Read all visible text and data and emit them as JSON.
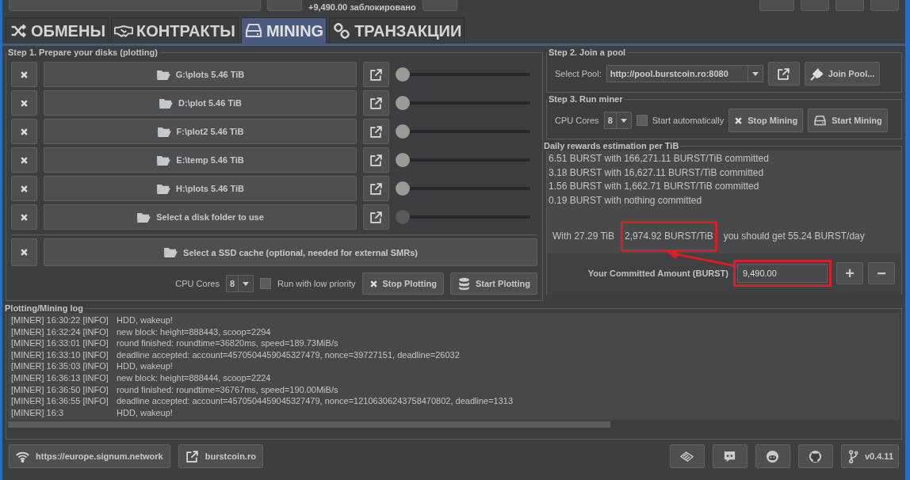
{
  "top_bar": {
    "locked_amount": "+9,490.00 заблокировано"
  },
  "tabs": [
    {
      "label": "ОБМЕНЫ",
      "selected": false
    },
    {
      "label": "КОНТРАКТЫ",
      "selected": false
    },
    {
      "label": "MINING",
      "selected": true
    },
    {
      "label": "ТРАНЗАКЦИИ",
      "selected": false
    }
  ],
  "plotting": {
    "title": "Step 1. Prepare your disks (plotting)",
    "disks": [
      {
        "label": "G:\\plots 5.46 TiB",
        "level": 0,
        "disabled": false
      },
      {
        "label": "D:\\plot 5.46 TiB",
        "level": 0,
        "disabled": false
      },
      {
        "label": "F:\\plot2 5.46 TiB",
        "level": 0,
        "disabled": false
      },
      {
        "label": "E:\\temp 5.46 TiB",
        "level": 0,
        "disabled": false
      },
      {
        "label": "H:\\plots 5.46 TiB",
        "level": 0,
        "disabled": false
      },
      {
        "label": "Select a disk folder to use",
        "level": 0,
        "disabled": true
      }
    ],
    "ssd_cache": "Select a SSD cache (optional, needed for external SMRs)",
    "cpu_label": "CPU Cores",
    "cpu_value": "8",
    "low_priority": {
      "label": "Run with low priority",
      "checked": false
    },
    "stop_button": "Stop Plotting",
    "start_button": "Start Plotting"
  },
  "pool": {
    "title": "Step 2. Join a pool",
    "label": "Select Pool:",
    "value": "http://pool.burstcoin.ro:8080",
    "join_button": "Join Pool..."
  },
  "miner": {
    "title": "Step 3. Run miner",
    "cpu_label": "CPU Cores",
    "cpu_value": "8",
    "auto_start": {
      "label": "Start automatically",
      "checked": false
    },
    "stop_button": "Stop Mining",
    "start_button": "Start Mining"
  },
  "rewards": {
    "title": "Daily rewards estimation per TiB",
    "lines": [
      "6.51 BURST with 166,271.11 BURST/TiB committed",
      "3.18 BURST with 16,627.11 BURST/TiB committed",
      "1.56 BURST with 1,662.71 BURST/TiB committed",
      "0.19 BURST with nothing committed"
    ],
    "summary": [
      {
        "text": "With 27.29 TiB",
        "highlighted": false
      },
      {
        "text": "2,974.92 BURST/TiB",
        "highlighted": true
      },
      {
        "text": "you should get 55.24 BURST/day",
        "highlighted": false
      }
    ],
    "committed_label": "Your Committed Amount (BURST)",
    "committed_value": "9,490.00",
    "committed_highlighted": true,
    "plus": "+",
    "minus": "−"
  },
  "log": {
    "title": "Plotting/Mining log",
    "entries": [
      {
        "prefix": "[MINER] 16:30:22 [INFO]",
        "message": "HDD, wakeup!"
      },
      {
        "prefix": "[MINER] 16:32:24 [INFO]",
        "message": "new block: height=888443, scoop=2294"
      },
      {
        "prefix": "[MINER] 16:33:01 [INFO]",
        "message": "round finished: roundtime=36820ms, speed=189.73MiB/s"
      },
      {
        "prefix": "[MINER] 16:33:10 [INFO]",
        "message": "deadline accepted: account=4570504459045327479, nonce=39727151, deadline=26032"
      },
      {
        "prefix": "[MINER] 16:35:03 [INFO]",
        "message": "HDD, wakeup!"
      },
      {
        "prefix": "[MINER] 16:36:13 [INFO]",
        "message": "new block: height=888444, scoop=2224"
      },
      {
        "prefix": "[MINER] 16:36:50 [INFO]",
        "message": "round finished: roundtime=36767ms, speed=190.00MiB/s"
      },
      {
        "prefix": "[MINER] 16:36:55 [INFO]",
        "message": "deadline accepted: account=4570504459045327479, nonce=12106306243758470802, deadline=1313"
      },
      {
        "prefix": "[MINER] 16:3",
        "message": "HDD, wakeup!"
      }
    ]
  },
  "footer": {
    "node": "https://europe.signum.network",
    "site": "burstcoin.ro",
    "version": "v0.4.11"
  }
}
